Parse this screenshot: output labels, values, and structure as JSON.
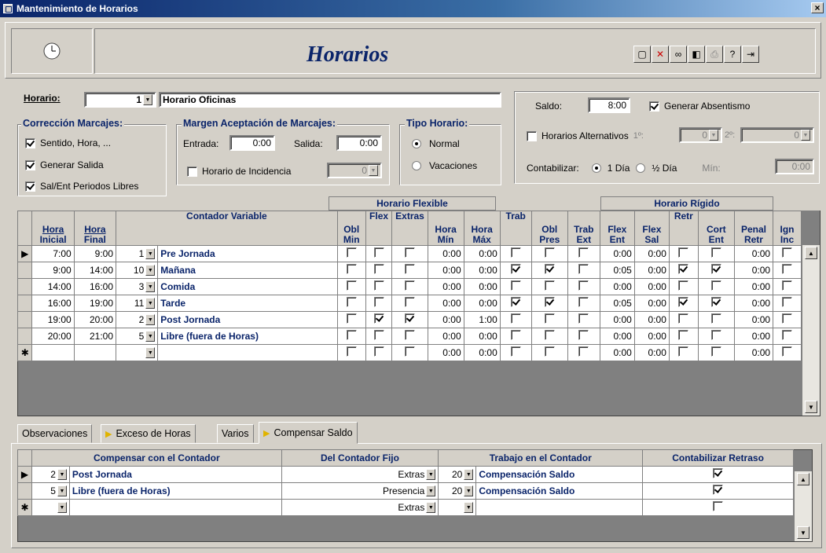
{
  "window": {
    "title": "Mantenimiento de Horarios",
    "close": "×"
  },
  "header": {
    "title": "Horarios"
  },
  "toolbar": {
    "icons": [
      "new-icon",
      "delete-icon",
      "find-icon",
      "preview-icon",
      "print-icon",
      "help-icon",
      "exit-icon"
    ]
  },
  "horario": {
    "label": "Horario:",
    "number": "1",
    "name": "Horario Oficinas"
  },
  "saldo": {
    "label": "Saldo:",
    "value": "8:00",
    "absentismo": "Generar Absentismo",
    "absentismo_checked": true
  },
  "alternativos": {
    "label": "Horarios Alternativos",
    "first_label": "1º:",
    "first_value": "0",
    "second_label": "2º:",
    "second_value": "0"
  },
  "contabilizar": {
    "label": "Contabilizar:",
    "opt1": "1 Día",
    "opt2": "½ Día",
    "min_label": "Mín:",
    "min_value": "0:00"
  },
  "correccion": {
    "title": "Corrección Marcajes:",
    "items": [
      {
        "label": "Sentido, Hora, ...",
        "checked": true
      },
      {
        "label": "Generar Salida",
        "checked": true
      },
      {
        "label": "Sal/Ent Periodos Libres",
        "checked": true
      }
    ]
  },
  "margen": {
    "title": "Margen Aceptación de Marcajes:",
    "entrada_label": "Entrada:",
    "entrada": "0:00",
    "salida_label": "Salida:",
    "salida": "0:00",
    "incidencia_label": "Horario de Incidencia",
    "incidencia_value": "0"
  },
  "tipo": {
    "title": "Tipo Horario:",
    "normal": "Normal",
    "vacaciones": "Vacaciones"
  },
  "grid": {
    "group_flexible": "Horario Flexible",
    "group_rigido": "Horario Rígido",
    "headers": [
      [
        "Hora",
        "Inicial"
      ],
      [
        "Hora",
        "Final"
      ],
      [
        "Contador Variable",
        ""
      ],
      [
        "Obl",
        "Min"
      ],
      [
        "Flex",
        ""
      ],
      [
        "Extras",
        ""
      ],
      [
        "Hora",
        "Mín"
      ],
      [
        "Hora",
        "Máx"
      ],
      [
        "Trab",
        ""
      ],
      [
        "Obl",
        "Pres"
      ],
      [
        "Trab",
        "Ext"
      ],
      [
        "Flex",
        "Ent"
      ],
      [
        "Flex",
        "Sal"
      ],
      [
        "Retr",
        ""
      ],
      [
        "Cort",
        "Ent"
      ],
      [
        "Penal",
        "Retr"
      ],
      [
        "Ign",
        "Inc"
      ]
    ],
    "rows": [
      {
        "ini": "7:00",
        "fin": "9:00",
        "cnum": "1",
        "cname": "Pre Jornada",
        "obl": false,
        "flex": false,
        "ext": false,
        "hmin": "0:00",
        "hmax": "0:00",
        "trab": false,
        "oblp": false,
        "trabx": false,
        "fent": "0:00",
        "fsal": "0:00",
        "retr": false,
        "cort": false,
        "pen": "0:00",
        "ign": false
      },
      {
        "ini": "9:00",
        "fin": "14:00",
        "cnum": "10",
        "cname": "Mañana",
        "obl": false,
        "flex": false,
        "ext": false,
        "hmin": "0:00",
        "hmax": "0:00",
        "trab": true,
        "oblp": true,
        "trabx": false,
        "fent": "0:05",
        "fsal": "0:00",
        "retr": true,
        "cort": true,
        "pen": "0:00",
        "ign": false
      },
      {
        "ini": "14:00",
        "fin": "16:00",
        "cnum": "3",
        "cname": "Comida",
        "obl": false,
        "flex": false,
        "ext": false,
        "hmin": "0:00",
        "hmax": "0:00",
        "trab": false,
        "oblp": false,
        "trabx": false,
        "fent": "0:00",
        "fsal": "0:00",
        "retr": false,
        "cort": false,
        "pen": "0:00",
        "ign": false
      },
      {
        "ini": "16:00",
        "fin": "19:00",
        "cnum": "11",
        "cname": "Tarde",
        "obl": false,
        "flex": false,
        "ext": false,
        "hmin": "0:00",
        "hmax": "0:00",
        "trab": true,
        "oblp": true,
        "trabx": false,
        "fent": "0:05",
        "fsal": "0:00",
        "retr": true,
        "cort": true,
        "pen": "0:00",
        "ign": false
      },
      {
        "ini": "19:00",
        "fin": "20:00",
        "cnum": "2",
        "cname": "Post Jornada",
        "obl": false,
        "flex": true,
        "ext": true,
        "hmin": "0:00",
        "hmax": "1:00",
        "trab": false,
        "oblp": false,
        "trabx": false,
        "fent": "0:00",
        "fsal": "0:00",
        "retr": false,
        "cort": false,
        "pen": "0:00",
        "ign": false
      },
      {
        "ini": "20:00",
        "fin": "21:00",
        "cnum": "5",
        "cname": "Libre (fuera de Horas)",
        "obl": false,
        "flex": false,
        "ext": false,
        "hmin": "0:00",
        "hmax": "0:00",
        "trab": false,
        "oblp": false,
        "trabx": false,
        "fent": "0:00",
        "fsal": "0:00",
        "retr": false,
        "cort": false,
        "pen": "0:00",
        "ign": false
      },
      {
        "ini": "",
        "fin": "",
        "cnum": "",
        "cname": "",
        "obl": false,
        "flex": false,
        "ext": false,
        "hmin": "0:00",
        "hmax": "0:00",
        "trab": false,
        "oblp": false,
        "trabx": false,
        "fent": "0:00",
        "fsal": "0:00",
        "retr": false,
        "cort": false,
        "pen": "0:00",
        "ign": false,
        "new": true
      }
    ]
  },
  "tabs": [
    {
      "label": "Observaciones",
      "arrow": false
    },
    {
      "label": "Exceso de Horas",
      "arrow": true
    },
    {
      "label": "Varios",
      "arrow": false
    },
    {
      "label": "Compensar Saldo",
      "arrow": true,
      "active": true
    }
  ],
  "subgrid": {
    "headers": [
      "Compensar con el Contador",
      "Del Contador Fijo",
      "Trabajo en el Contador",
      "Contabilizar Retraso"
    ],
    "rows": [
      {
        "cnum": "2",
        "cname": "Post Jornada",
        "fijo": "Extras",
        "tnum": "20",
        "tname": "Compensación Saldo",
        "retraso": true
      },
      {
        "cnum": "5",
        "cname": "Libre (fuera de Horas)",
        "fijo": "Presencia",
        "tnum": "20",
        "tname": "Compensación Saldo",
        "retraso": true
      },
      {
        "cnum": "",
        "cname": "",
        "fijo": "Extras",
        "tnum": "",
        "tname": "",
        "retraso": false,
        "new": true
      }
    ]
  },
  "markers": {
    "current": "▶",
    "new": "✱"
  }
}
